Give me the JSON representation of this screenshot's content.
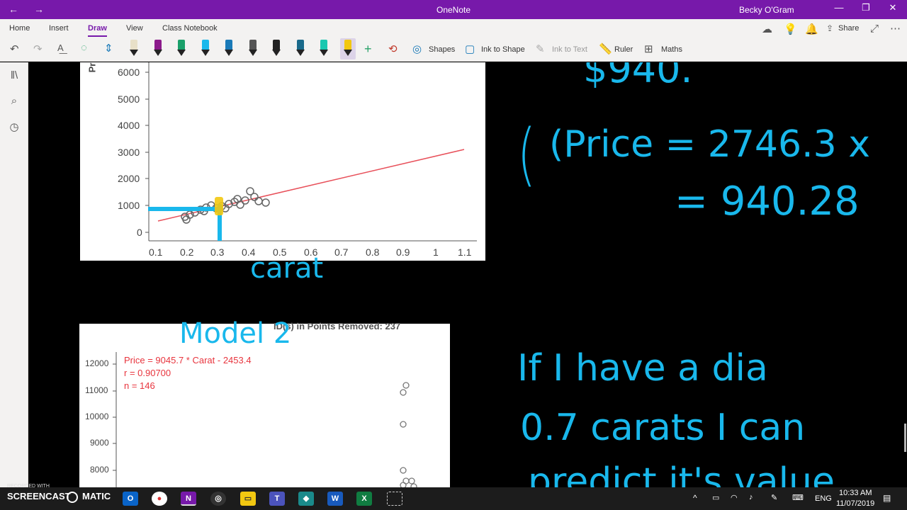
{
  "titlebar": {
    "app_title": "OneNote",
    "user": "Becky O'Gram",
    "back_glyph": "←",
    "forward_glyph": "→",
    "minimize_glyph": "—",
    "restore_glyph": "❐",
    "close_glyph": "✕"
  },
  "ribbon": {
    "tabs": [
      "Home",
      "Insert",
      "Draw",
      "View",
      "Class Notebook"
    ],
    "active_tab": "Draw",
    "share_label": "Share",
    "shapes_label": "Shapes",
    "ink_to_shape_label": "Ink to Shape",
    "ink_to_text_label": "Ink to Text",
    "ruler_label": "Ruler",
    "maths_label": "Maths",
    "pen_colors": [
      "#e8e0c8",
      "#8b1a8b",
      "#1aa06a",
      "#19b8ec",
      "#1a7ab8",
      "#555555",
      "#222222",
      "#1a6a8b",
      "#19c8b0",
      "#f2c811"
    ]
  },
  "plot1": {
    "y_ticks": [
      "6000",
      "5000",
      "4000",
      "3000",
      "2000",
      "1000",
      "0"
    ],
    "x_ticks": [
      "0.1",
      "0.2",
      "0.3",
      "0.4",
      "0.5",
      "0.6",
      "0.7",
      "0.8",
      "0.9",
      "1",
      "1.1"
    ],
    "ylabel_partial": "Pr",
    "ink_label": "carat"
  },
  "plot2": {
    "header_partial": "ID(s) in Points Removed: 237",
    "equation": "Price = 9045.7 * Carat - 2453.4",
    "r_value": "r = 0.90700",
    "n_value": "n = 146",
    "y_ticks": [
      "12000",
      "11000",
      "10000",
      "9000",
      "8000"
    ],
    "ink_label": "Model 2"
  },
  "ink": {
    "line1": "$940.",
    "line2": "(Price = 2746.3 x",
    "line3": "= 940.28",
    "line4": "If I have a dia",
    "line5": "0.7 carats I can",
    "line6": "predict it's value"
  },
  "watermark": {
    "small": "RECORDED WITH",
    "brand": "SCREENCAST",
    "brand2": "MATIC"
  },
  "taskbar": {
    "time": "10:33 AM",
    "date": "11/07/2019",
    "lang": "ENG"
  }
}
